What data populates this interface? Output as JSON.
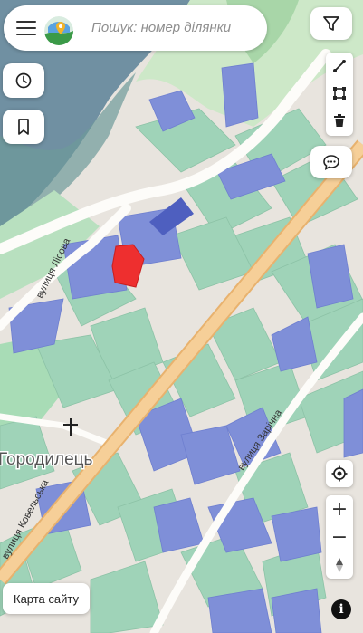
{
  "search": {
    "placeholder": "Пошук: номер ділянки",
    "menu_icon": "hamburger-icon",
    "logo": "map-logo"
  },
  "map_labels": {
    "street_lisova": "вулиця Лісова",
    "street_kovelska": "вулиця Ковельська",
    "street_zarichna": "вулиця Зарічна",
    "village": "Городилець"
  },
  "buttons": {
    "filter": "filter-icon",
    "history": "clock-icon",
    "bookmark": "bookmark-icon",
    "draw_line": "ruler-icon",
    "draw_polygon": "polygon-icon",
    "delete": "trash-icon",
    "chat": "chat-icon",
    "locate": "locate-icon",
    "zoom_in": "+",
    "zoom_out": "−",
    "compass": "compass-icon"
  },
  "map_site_label": "Карта сайту",
  "info_label": "i",
  "colors": {
    "parcel_green": "#a9d8c0",
    "parcel_blue": "#7d8fd6",
    "parcel_dark_blue": "#4e5fbf",
    "highlight_red": "#ee2f2f",
    "main_road": "#f6c98c",
    "water": "#6f8fa0"
  }
}
